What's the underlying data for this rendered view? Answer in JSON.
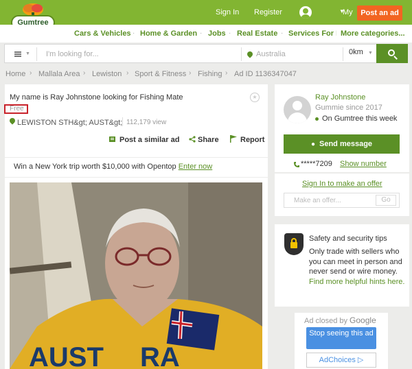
{
  "header": {
    "logo_text": "Gumtree",
    "sign_in": "Sign In",
    "register": "Register",
    "my_label": "My",
    "post_ad": "Post an ad"
  },
  "categories": [
    "Cars & Vehicles",
    "Home & Garden",
    "Jobs",
    "Real Estate",
    "Services For I",
    "More categories..."
  ],
  "search": {
    "placeholder": "I'm looking for...",
    "location_placeholder": "Australia",
    "distance": "0km"
  },
  "breadcrumb": [
    "Home",
    "Mallala Area",
    "Lewiston",
    "Sport & Fitness",
    "Fishing",
    "Ad ID 1136347047"
  ],
  "ad": {
    "title": "My name is Ray Johnstone looking for Fishing Mate",
    "price": "Free",
    "location": "LEWISTON STH&gt; AUST&gt;",
    "views": "112,179 view",
    "actions": {
      "post_similar": "Post a similar ad",
      "share": "Share",
      "report": "Report"
    },
    "promo_text": "Win a New York trip worth $10,000 with Opentop",
    "promo_link": "Enter now"
  },
  "seller": {
    "name": "Ray Johnstone",
    "since": "Gummie since 2017",
    "status": "On Gumtree this week",
    "message_button": "Send message",
    "phone": "*****7209",
    "show_number": "Show number",
    "sign_in_offer": "Sign In to make an offer",
    "offer_placeholder": "Make an offer...",
    "go_button": "Go"
  },
  "safety": {
    "title": "Safety and security tips",
    "body": "Only trade with sellers who you can meet in person and never send or wire money.",
    "link": "Find more helpful hints here."
  },
  "ad_panel": {
    "closed_by": "Ad closed by",
    "google": "Google",
    "stop_seeing": "Stop seeing this ad",
    "adchoices": "AdChoices ▷"
  },
  "colors": {
    "brand_green": "#82b532",
    "link_green": "#5b9026",
    "post_orange": "#f26522",
    "price_border_red": "#c8222a",
    "ad_blue": "#4a90e2"
  }
}
